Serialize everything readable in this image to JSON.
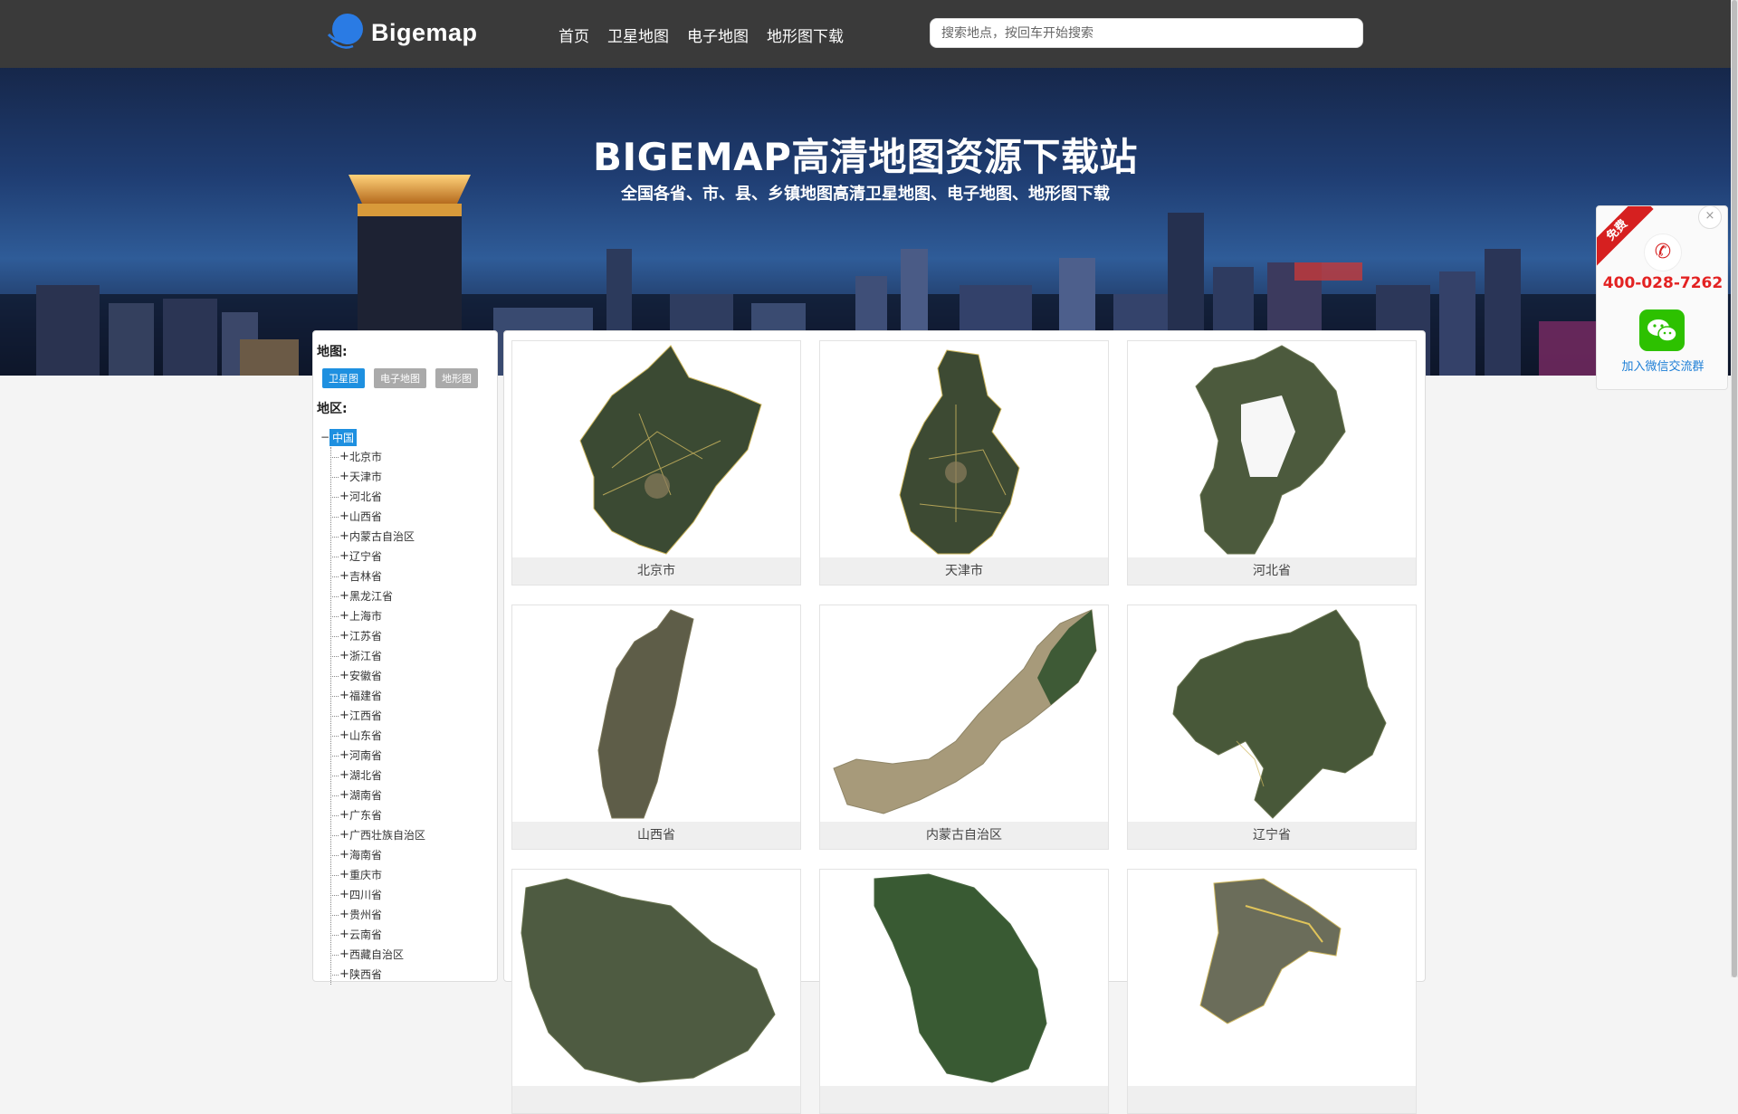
{
  "header": {
    "logo_text": "Bigemap",
    "nav": [
      "首页",
      "卫星地图",
      "电子地图",
      "地形图下载"
    ],
    "search_placeholder": "搜索地点，按回车开始搜索"
  },
  "banner": {
    "title": "BIGEMAP高清地图资源下载站",
    "subtitle": "全国各省、市、县、乡镇地图高清卫星地图、电子地图、地形图下载"
  },
  "sidebar": {
    "map_heading": "地图:",
    "map_types": [
      "卫星图",
      "电子地图",
      "地形图"
    ],
    "region_heading": "地区:",
    "root": "中国",
    "regions": [
      "北京市",
      "天津市",
      "河北省",
      "山西省",
      "内蒙古自治区",
      "辽宁省",
      "吉林省",
      "黑龙江省",
      "上海市",
      "江苏省",
      "浙江省",
      "安徽省",
      "福建省",
      "江西省",
      "山东省",
      "河南省",
      "湖北省",
      "湖南省",
      "广东省",
      "广西壮族自治区",
      "海南省",
      "重庆市",
      "四川省",
      "贵州省",
      "云南省",
      "西藏自治区",
      "陕西省"
    ]
  },
  "cards": [
    "北京市",
    "天津市",
    "河北省",
    "山西省",
    "内蒙古自治区",
    "辽宁省",
    "",
    "",
    ""
  ],
  "float_widget": {
    "ribbon": "免费",
    "close_symbol": "×",
    "phone": "400-028-7262",
    "wechat_label": "加入微信交流群"
  },
  "colors": {
    "header_bg": "#3a3a3a",
    "accent": "#1e90e0",
    "phone_red": "#e32222",
    "wechat_green": "#2dc100"
  }
}
